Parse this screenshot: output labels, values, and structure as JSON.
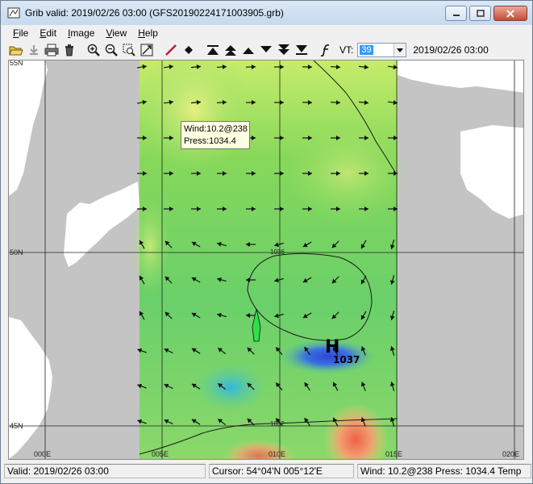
{
  "window": {
    "title": "Grib valid: 2019/02/26 03:00 (GFS20190224171003905.grb)"
  },
  "menu": [
    {
      "label": "File",
      "accel": "F",
      "rest": "ile"
    },
    {
      "label": "Edit",
      "accel": "E",
      "rest": "dit"
    },
    {
      "label": "Image",
      "accel": "I",
      "rest": "mage"
    },
    {
      "label": "View",
      "accel": "V",
      "rest": "iew"
    },
    {
      "label": "Help",
      "accel": "H",
      "rest": "elp"
    }
  ],
  "toolbar": {
    "vt_label": "VT:",
    "vt_value": "39",
    "valid_time": "2019/02/26 03:00",
    "icons": [
      "open-folder-icon",
      "save-icon",
      "print-icon",
      "delete-icon",
      "zoom-in-icon",
      "zoom-out-icon",
      "zoom-box-icon",
      "zoom-fit-icon",
      "pen-icon",
      "diamond-icon",
      "first-frame-icon",
      "fast-back-icon",
      "step-back-icon",
      "step-forward-icon",
      "fast-forward-icon",
      "last-frame-icon",
      "function-icon"
    ]
  },
  "map": {
    "tooltip_line1": "Wind:10.2@238",
    "tooltip_line2": "Press:1034.4",
    "high_label": "H",
    "high_value": "1037",
    "lat_labels": [
      "55N",
      "50N",
      "45N"
    ],
    "lon_labels": [
      "000E",
      "005E",
      "010E",
      "015E",
      "020E"
    ],
    "isobar_labels": [
      "1036",
      "1032"
    ]
  },
  "status": {
    "valid": "Valid: 2019/02/26 03:00",
    "cursor": "Cursor: 54°04'N  005°12'E",
    "wind": "Wind: 10.2@238  Press: 1034.4  Temp"
  }
}
